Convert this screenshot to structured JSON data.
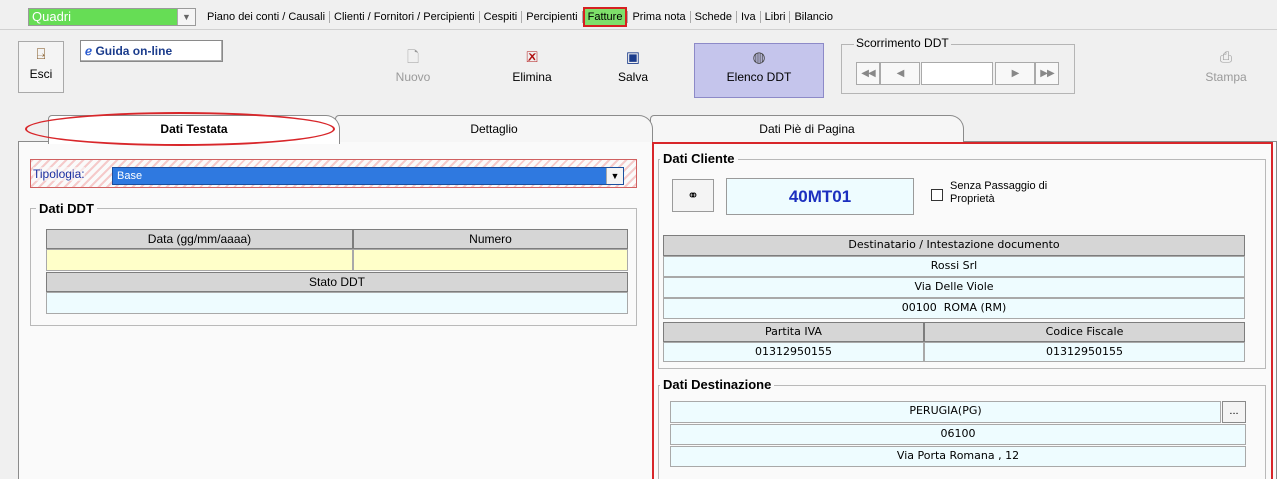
{
  "menubar": {
    "module": "Quadri",
    "items": [
      "Piano dei conti / Causali",
      "Clienti / Fornitori / Percipienti",
      "Cespiti",
      "Percipienti",
      "Fatture",
      "Prima nota",
      "Schede",
      "Iva",
      "Libri",
      "Bilancio"
    ],
    "active_item": "Fatture"
  },
  "toolbar": {
    "esci": "Esci",
    "guida": "Guida on-line",
    "nuovo": "Nuovo",
    "elimina": "Elimina",
    "salva": "Salva",
    "elenco": "Elenco DDT",
    "scorrimento": "Scorrimento DDT",
    "stampa": "Stampa"
  },
  "tabs": [
    "Dati Testata",
    "Dettaglio",
    "Dati Piè di Pagina"
  ],
  "testata": {
    "tipologia_label": "Tipologia:",
    "tipologia_value": "Base",
    "dati_ddt_title": "Dati DDT",
    "col_data": "Data (gg/mm/aaaa)",
    "col_numero": "Numero",
    "col_stato": "Stato DDT",
    "data_value": "",
    "numero_value": "",
    "stato_value": ""
  },
  "cliente": {
    "title": "Dati Cliente",
    "codice": "40MT01",
    "senza_passaggio": "Senza Passaggio di Proprietà",
    "dest_header": "Destinatario / Intestazione documento",
    "ragione_sociale": "Rossi Srl",
    "indirizzo": "Via Delle Viole",
    "cap_citta": "00100  ROMA (RM)",
    "piva_header": "Partita IVA",
    "cf_header": "Codice Fiscale",
    "piva": "01312950155",
    "cf": "01312950155"
  },
  "destinazione": {
    "title": "Dati Destinazione",
    "citta": "PERUGIA(PG)",
    "cap": "06100",
    "indirizzo": "Via Porta Romana , 12",
    "button": "..."
  },
  "colors": {
    "accent_green": "#66dd55",
    "highlight_red": "#d8262a",
    "selected_blue": "#2f79e0",
    "code_blue": "#1c2fbf"
  }
}
